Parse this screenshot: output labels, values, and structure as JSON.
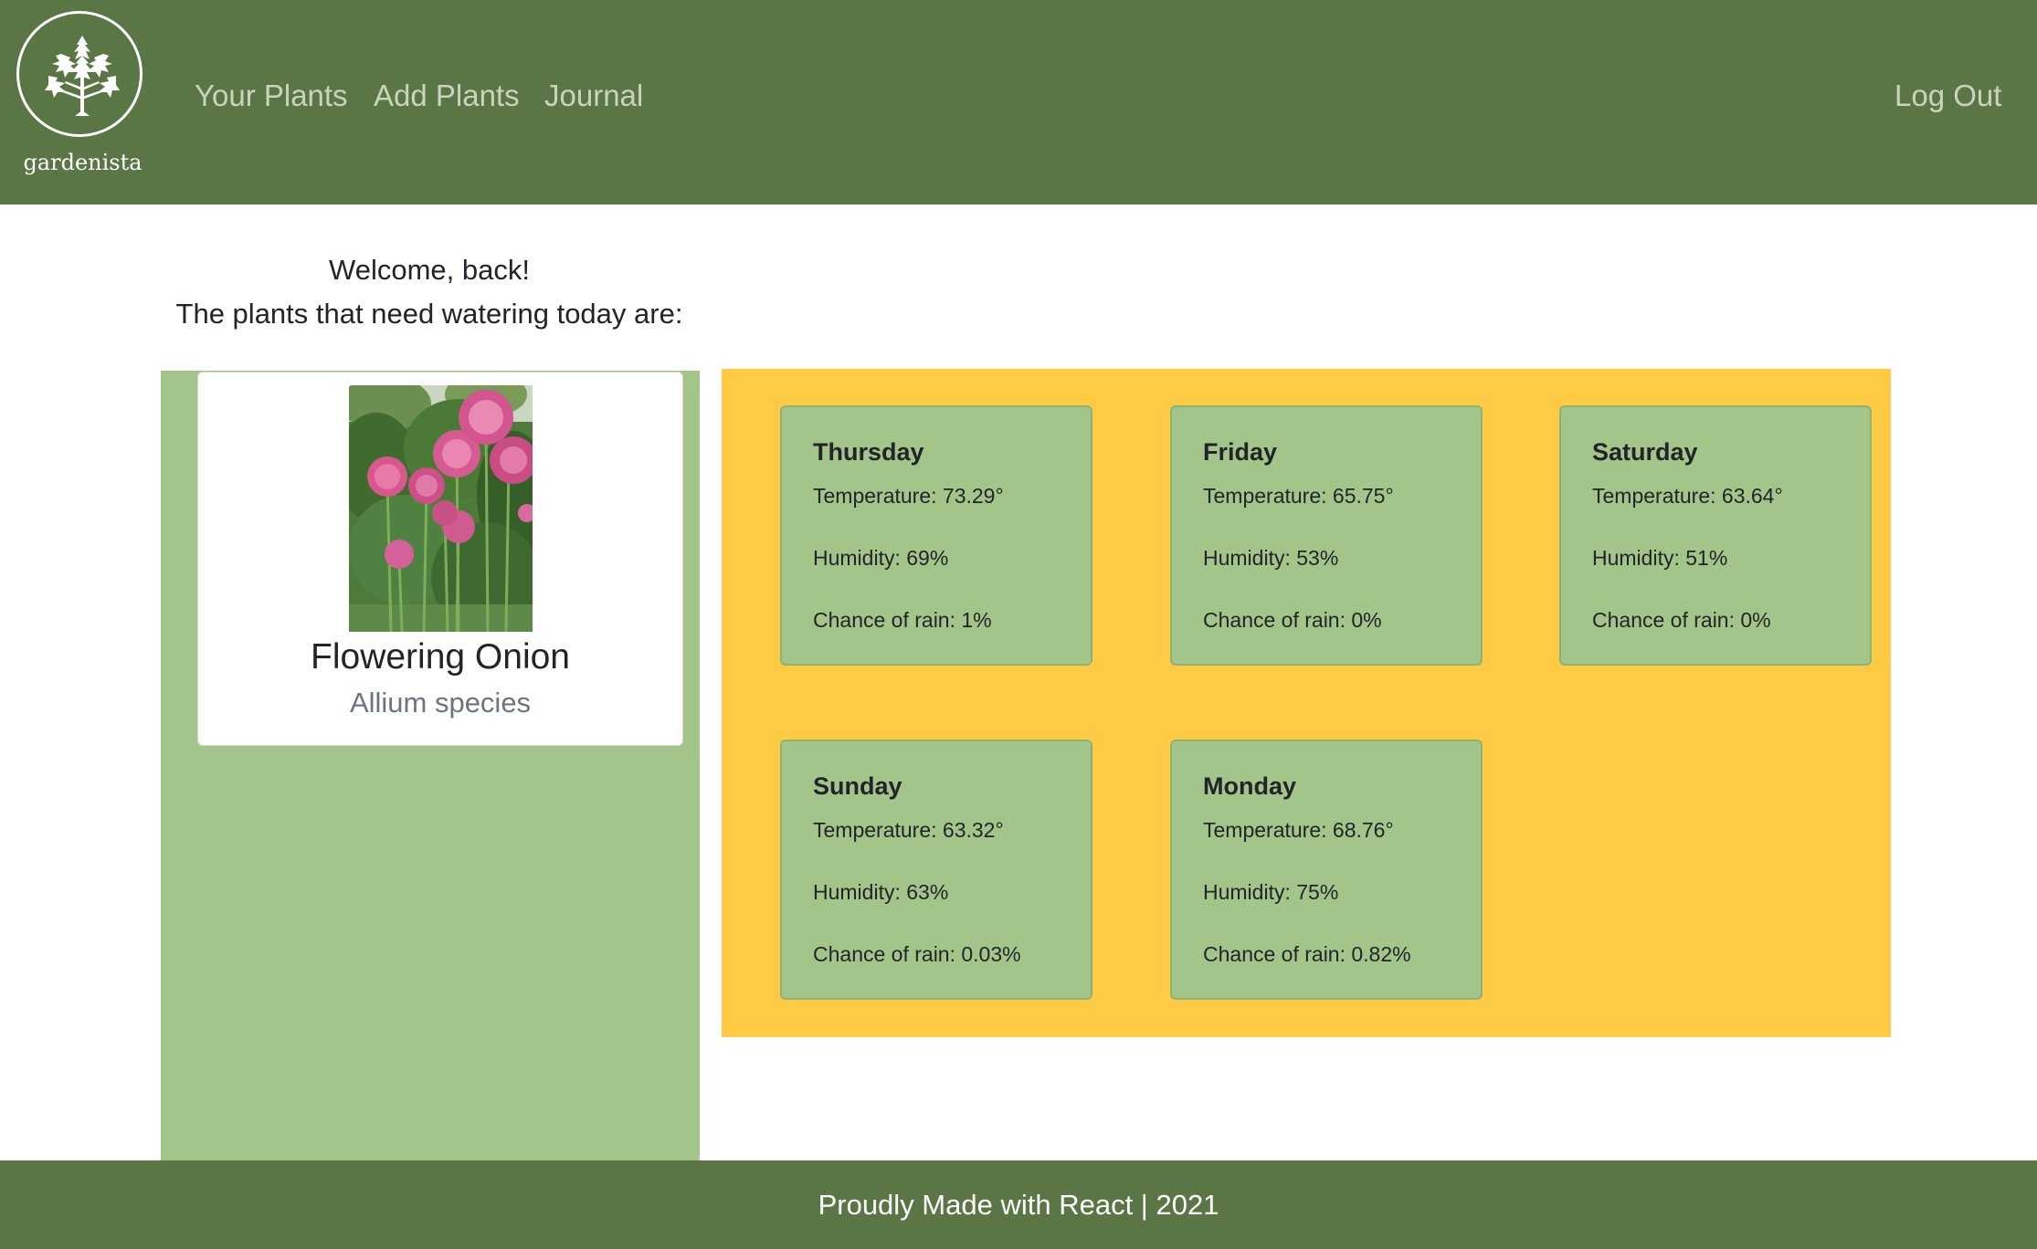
{
  "header": {
    "logo_text": "gardenista",
    "nav": {
      "your_plants": "Your Plants",
      "add_plants": "Add Plants",
      "journal": "Journal",
      "log_out": "Log Out"
    }
  },
  "welcome": {
    "greeting": "Welcome, back!",
    "subtitle": "The plants that need watering today are:"
  },
  "plants": [
    {
      "name": "Flowering Onion",
      "species": "Allium species"
    }
  ],
  "forecast": [
    {
      "day": "Thursday",
      "temperature": "Temperature: 73.29°",
      "humidity": "Humidity: 69%",
      "rain": "Chance of rain: 1%"
    },
    {
      "day": "Friday",
      "temperature": "Temperature: 65.75°",
      "humidity": "Humidity: 53%",
      "rain": "Chance of rain: 0%"
    },
    {
      "day": "Saturday",
      "temperature": "Temperature: 63.64°",
      "humidity": "Humidity: 51%",
      "rain": "Chance of rain: 0%"
    },
    {
      "day": "Sunday",
      "temperature": "Temperature: 63.32°",
      "humidity": "Humidity: 63%",
      "rain": "Chance of rain: 0.03%"
    },
    {
      "day": "Monday",
      "temperature": "Temperature: 68.76°",
      "humidity": "Humidity: 75%",
      "rain": "Chance of rain: 0.82%"
    }
  ],
  "footer": {
    "text": "Proudly Made with React | 2021"
  },
  "colors": {
    "header_bg": "#5b7645",
    "nav_link": "#c8d4bd",
    "plant_column_bg": "#a3c589",
    "weather_panel_bg": "#ffcb45",
    "weather_card_bg": "#a3c589",
    "species_text": "#6c757d"
  },
  "icons": {
    "logo": "tree-icon"
  }
}
